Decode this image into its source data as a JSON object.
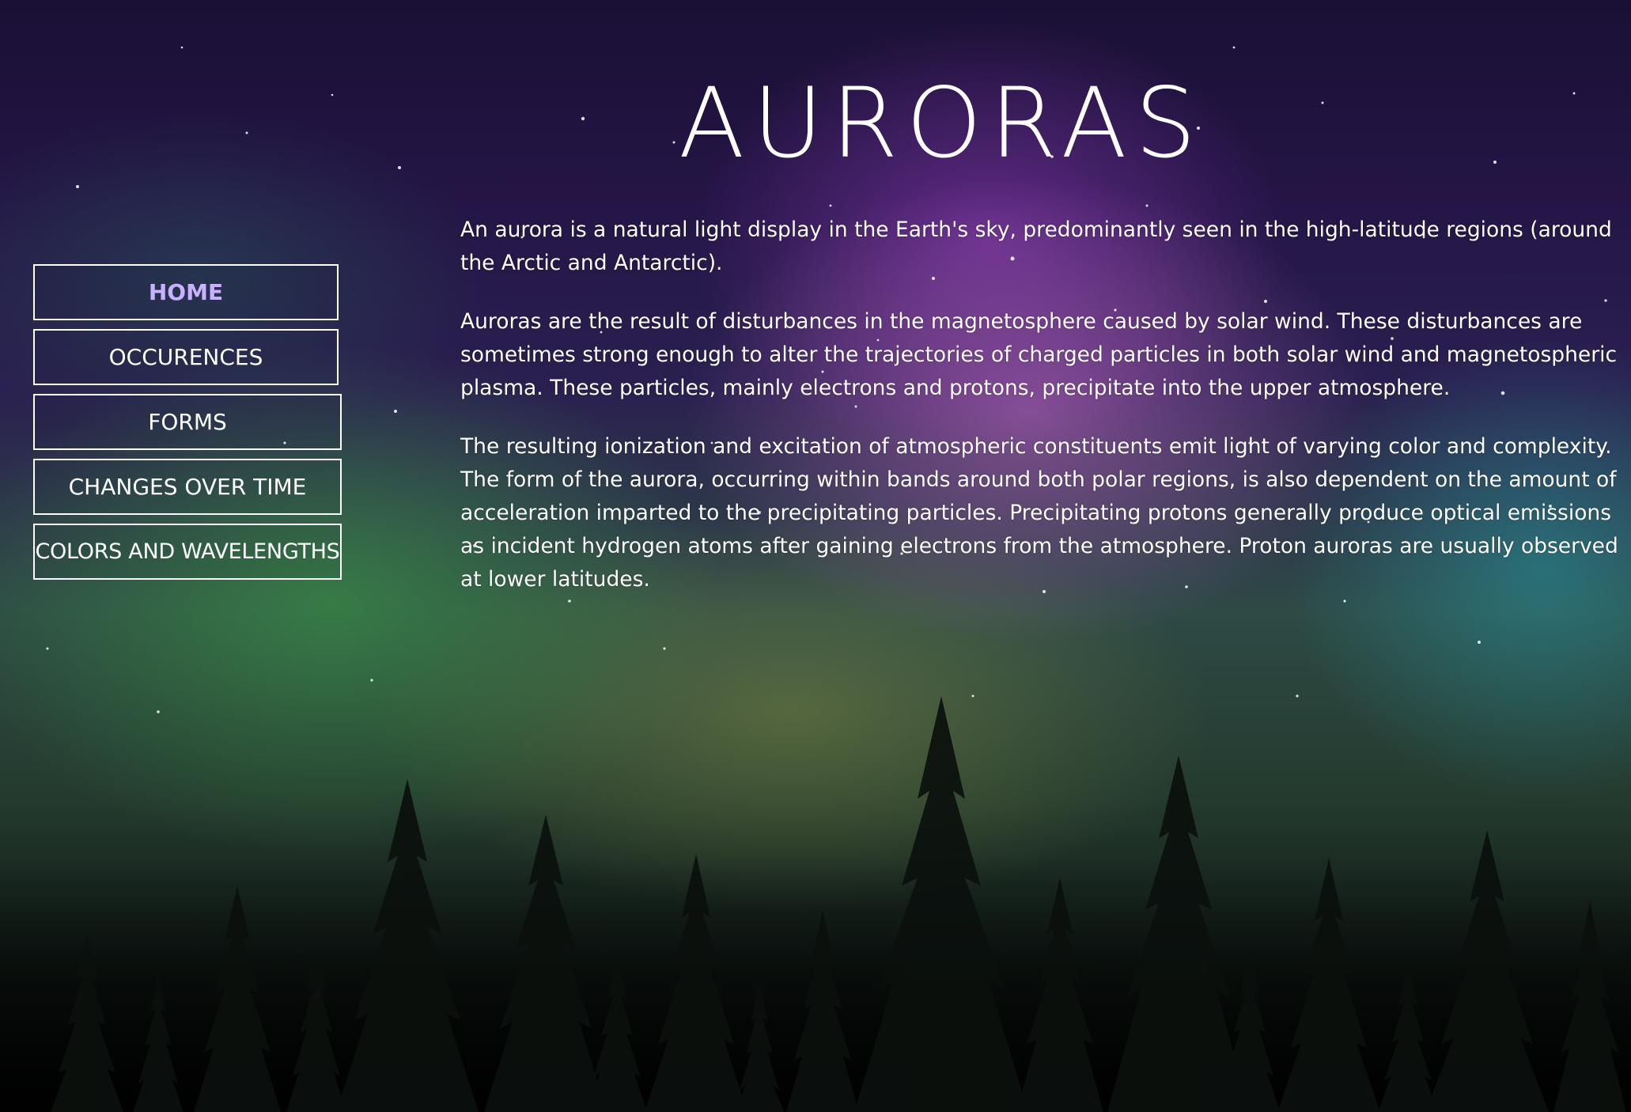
{
  "page": {
    "title": "AURORAS"
  },
  "nav": {
    "items": [
      {
        "label": "HOME",
        "active": true
      },
      {
        "label": "OCCURENCES",
        "active": false
      },
      {
        "label": "FORMS",
        "active": false
      },
      {
        "label": "CHANGES OVER TIME",
        "active": false
      },
      {
        "label": "COLORS AND WAVELENGTHS",
        "active": false
      }
    ]
  },
  "content": {
    "paragraphs": [
      "An aurora is a natural light display in the Earth's sky, predominantly seen in the high-latitude regions (around the Arctic and Antarctic).",
      "Auroras are the result of disturbances in the magnetosphere caused by solar wind. These disturbances are sometimes strong enough to alter the trajectories of charged particles in both solar wind and magnetospheric plasma. These particles, mainly electrons and protons, precipitate into the upper atmosphere.",
      "The resulting ionization and excitation of atmospheric constituents emit light of varying color and complexity. The form of the aurora, occurring within bands around both polar regions, is also dependent on the amount of acceleration imparted to the precipitating particles. Precipitating protons generally produce optical emissions as incident hydrogen atoms after gaining electrons from the atmosphere. Proton auroras are usually observed at lower latitudes."
    ]
  },
  "colors": {
    "active_nav": "#c9b1ff",
    "text": "#ffffff",
    "tree_silhouette": "#0b100d"
  },
  "background": {
    "description_icon": "aurora-night-sky-background"
  }
}
